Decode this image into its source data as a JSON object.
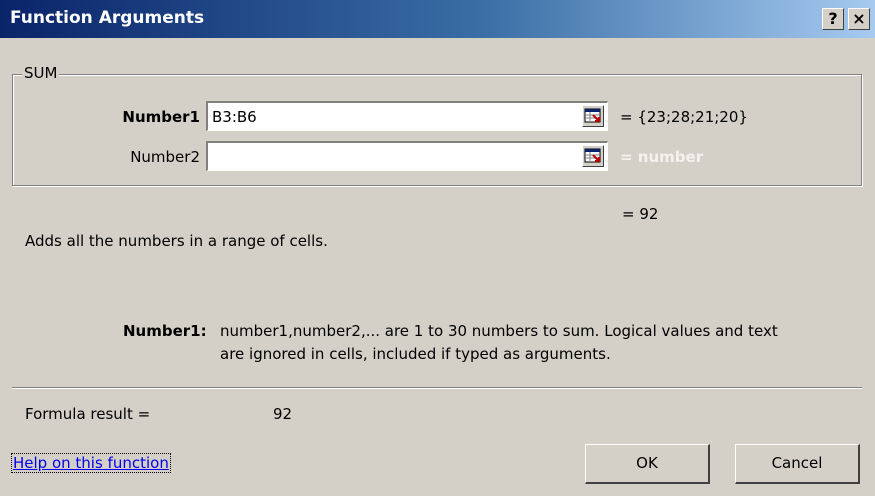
{
  "window": {
    "title": "Function Arguments",
    "help_button": "?",
    "close_button": "×"
  },
  "function_group": {
    "label": "SUM",
    "arguments": [
      {
        "label": "Number1",
        "value": "B3:B6",
        "result": "= {23;28;21;20}"
      },
      {
        "label": "Number2",
        "value": "",
        "result": "= number"
      }
    ]
  },
  "function_result": "= 92",
  "description": "Adds all the numbers in a range of cells.",
  "argument_help": {
    "label": "Number1:",
    "line1": "number1,number2,... are 1 to 30 numbers to sum. Logical values and text",
    "line2": "are ignored in cells, included if typed as arguments."
  },
  "formula_result": {
    "label": "Formula result =",
    "value": "92"
  },
  "help_link": "Help on this function",
  "buttons": {
    "ok": "OK",
    "cancel": "Cancel"
  }
}
